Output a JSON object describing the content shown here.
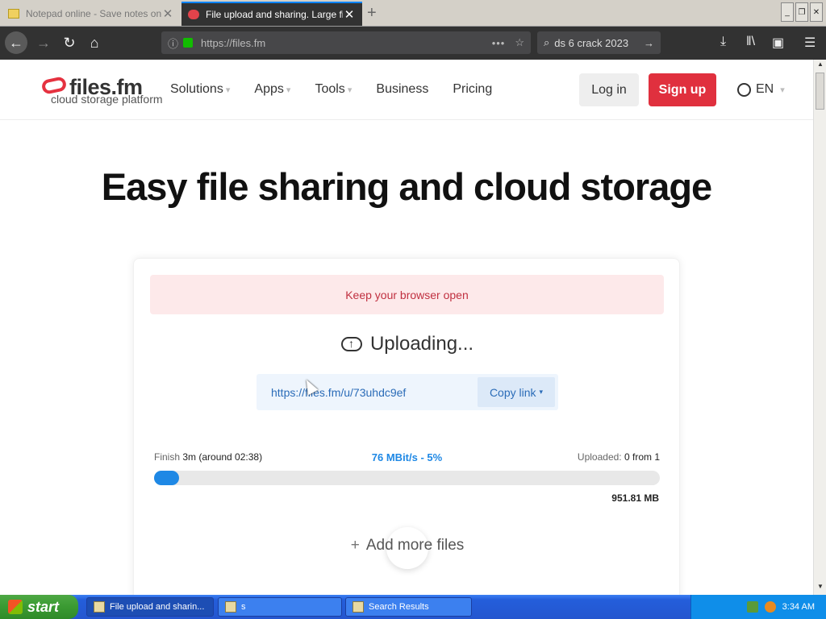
{
  "browser": {
    "tabs": [
      {
        "title": "Notepad online - Save notes online",
        "active": false
      },
      {
        "title": "File upload and sharing. Large file",
        "active": true
      }
    ],
    "url": "https://files.fm",
    "search_text": "ds 6 crack 2023"
  },
  "site": {
    "logo_name": "files.fm",
    "logo_tagline": "cloud storage platform",
    "nav": [
      "Solutions",
      "Apps",
      "Tools",
      "Business",
      "Pricing"
    ],
    "login": "Log in",
    "signup": "Sign up",
    "language": "EN",
    "accent_color": "#e0303e"
  },
  "hero": {
    "title": "Easy file sharing and cloud storage"
  },
  "upload": {
    "notice": "Keep your browser open",
    "status": "Uploading...",
    "share_link": "https://files.fm/u/73uhdc9ef",
    "copy_label": "Copy link",
    "finish_label": "Finish",
    "finish_value": "3m (around 02:38)",
    "speed": "76 MBit/s - 5%",
    "uploaded_label": "Uploaded:",
    "uploaded_value": "0 from 1",
    "progress_percent": 5,
    "total_size": "951.81 MB",
    "add_more": "Add more files",
    "progress_color": "#1e88e5"
  },
  "taskbar": {
    "start": "start",
    "tasks": [
      "File upload and sharin...",
      "s",
      "Search Results"
    ],
    "clock": "3:34 AM"
  }
}
